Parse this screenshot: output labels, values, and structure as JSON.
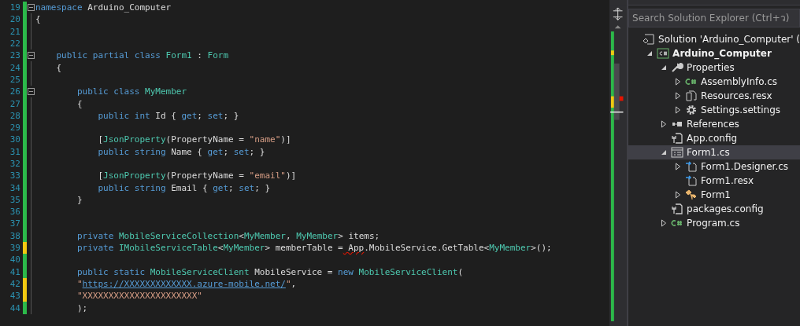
{
  "editor": {
    "lines": [
      {
        "number": "19",
        "color": "#2cb94a",
        "fold": true,
        "tokens": [
          {
            "kind": "kw",
            "text": "namespace"
          },
          {
            "kind": "plain",
            "text": " Arduino_Computer"
          }
        ]
      },
      {
        "number": "20",
        "color": "#2cb94a",
        "fold": false,
        "tokens": [
          {
            "kind": "plain",
            "text": "{"
          }
        ]
      },
      {
        "number": "21",
        "color": "#2cb94a",
        "fold": false
      },
      {
        "number": "22",
        "color": "#2cb94a",
        "fold": false
      },
      {
        "number": "23",
        "color": "#2cb94a",
        "fold": true,
        "tokens": [
          {
            "kind": "kw",
            "text": "    public partial class"
          },
          {
            "kind": "type",
            "text": " Form1"
          },
          {
            "kind": "plain",
            "text": " :"
          },
          {
            "kind": "type",
            "text": " Form"
          }
        ]
      },
      {
        "number": "24",
        "color": "#2cb94a",
        "fold": false,
        "tokens": [
          {
            "kind": "plain",
            "text": "    {"
          }
        ]
      },
      {
        "number": "25",
        "color": "#2cb94a",
        "fold": false
      },
      {
        "number": "26",
        "color": "#2cb94a",
        "fold": true,
        "tokens": [
          {
            "kind": "kw",
            "text": "        public class"
          },
          {
            "kind": "type",
            "text": " MyMember"
          }
        ]
      },
      {
        "number": "27",
        "color": "#2cb94a",
        "fold": false,
        "tokens": [
          {
            "kind": "plain",
            "text": "        {"
          }
        ]
      },
      {
        "number": "28",
        "color": "#2cb94a",
        "fold": false,
        "tokens": [
          {
            "kind": "kw",
            "text": "            public int"
          },
          {
            "kind": "plain",
            "text": " Id {"
          },
          {
            "kind": "kw",
            "text": " get"
          },
          {
            "kind": "plain",
            "text": ";"
          },
          {
            "kind": "kw",
            "text": " set"
          },
          {
            "kind": "plain",
            "text": "; }"
          }
        ]
      },
      {
        "number": "29",
        "color": "#2cb94a",
        "fold": false
      },
      {
        "number": "30",
        "color": "#2cb94a",
        "fold": false,
        "tokens": [
          {
            "kind": "plain",
            "text": "            ["
          },
          {
            "kind": "type",
            "text": "JsonProperty"
          },
          {
            "kind": "plain",
            "text": "(PropertyName ="
          },
          {
            "kind": "str",
            "text": " \"name\""
          },
          {
            "kind": "plain",
            "text": ")]"
          }
        ]
      },
      {
        "number": "31",
        "color": "#2cb94a",
        "fold": false,
        "tokens": [
          {
            "kind": "kw",
            "text": "            public string"
          },
          {
            "kind": "plain",
            "text": " Name {"
          },
          {
            "kind": "kw",
            "text": " get"
          },
          {
            "kind": "plain",
            "text": ";"
          },
          {
            "kind": "kw",
            "text": " set"
          },
          {
            "kind": "plain",
            "text": "; }"
          }
        ]
      },
      {
        "number": "32",
        "color": "#2cb94a",
        "fold": false
      },
      {
        "number": "33",
        "color": "#2cb94a",
        "fold": false,
        "tokens": [
          {
            "kind": "plain",
            "text": "            ["
          },
          {
            "kind": "type",
            "text": "JsonProperty"
          },
          {
            "kind": "plain",
            "text": "(PropertyName ="
          },
          {
            "kind": "str",
            "text": " \"email\""
          },
          {
            "kind": "plain",
            "text": ")]"
          }
        ]
      },
      {
        "number": "34",
        "color": "#2cb94a",
        "fold": false,
        "tokens": [
          {
            "kind": "kw",
            "text": "            public string"
          },
          {
            "kind": "plain",
            "text": " Email {"
          },
          {
            "kind": "kw",
            "text": " get"
          },
          {
            "kind": "plain",
            "text": ";"
          },
          {
            "kind": "kw",
            "text": " set"
          },
          {
            "kind": "plain",
            "text": "; }"
          }
        ]
      },
      {
        "number": "35",
        "color": "#2cb94a",
        "fold": false,
        "tokens": [
          {
            "kind": "plain",
            "text": "        }"
          }
        ]
      },
      {
        "number": "36",
        "color": "#2cb94a",
        "fold": false
      },
      {
        "number": "37",
        "color": "#2cb94a",
        "fold": false
      },
      {
        "number": "38",
        "color": "#2cb94a",
        "fold": false,
        "tokens": [
          {
            "kind": "kw",
            "text": "        private"
          },
          {
            "kind": "type",
            "text": " MobileServiceCollection"
          },
          {
            "kind": "plain",
            "text": "<"
          },
          {
            "kind": "type",
            "text": "MyMember"
          },
          {
            "kind": "plain",
            "text": ","
          },
          {
            "kind": "type",
            "text": " MyMember"
          },
          {
            "kind": "plain",
            "text": "> items;"
          }
        ]
      },
      {
        "number": "39",
        "color": "#f2c811",
        "fold": false,
        "tokens": [
          {
            "kind": "kw",
            "text": "        private"
          },
          {
            "kind": "type",
            "text": " IMobileServiceTable"
          },
          {
            "kind": "plain",
            "text": "<"
          },
          {
            "kind": "type",
            "text": "MyMember"
          },
          {
            "kind": "plain",
            "text": "> memberTable ="
          },
          {
            "kind": "error",
            "text": " App"
          },
          {
            "kind": "plain",
            "text": ".MobileService.GetTable<"
          },
          {
            "kind": "type",
            "text": "MyMember"
          },
          {
            "kind": "plain",
            "text": ">();"
          }
        ]
      },
      {
        "number": "40",
        "color": "#2cb94a",
        "fold": false
      },
      {
        "number": "41",
        "color": "#2cb94a",
        "fold": false,
        "tokens": [
          {
            "kind": "kw",
            "text": "        public static"
          },
          {
            "kind": "type",
            "text": " MobileServiceClient"
          },
          {
            "kind": "plain",
            "text": " MobileService ="
          },
          {
            "kind": "kw",
            "text": " new"
          },
          {
            "kind": "type",
            "text": " MobileServiceClient"
          },
          {
            "kind": "plain",
            "text": "("
          }
        ]
      },
      {
        "number": "42",
        "color": "#f2c811",
        "fold": false,
        "tokens": [
          {
            "kind": "str",
            "text": "        \""
          },
          {
            "kind": "link",
            "text": "https://XXXXXXXXXXXXX.azure-mobile.net/"
          },
          {
            "kind": "str",
            "text": "\""
          },
          {
            "kind": "plain",
            "text": ","
          }
        ]
      },
      {
        "number": "43",
        "color": "#f2c811",
        "fold": false,
        "tokens": [
          {
            "kind": "str",
            "text": "        \"XXXXXXXXXXXXXXXXXXXXXX\""
          }
        ]
      },
      {
        "number": "44",
        "color": "#2cb94a",
        "fold": false,
        "tokens": [
          {
            "kind": "plain",
            "text": "        );"
          }
        ]
      }
    ]
  },
  "solution_explorer": {
    "search": {
      "placeholder": "Search Solution Explorer (Ctrl+ว)"
    },
    "tree": [
      {
        "label": "Solution 'Arduino_Computer' (",
        "kind": "solution",
        "selected": false,
        "children": [
          {
            "label": "Arduino_Computer",
            "kind": "project",
            "expanded": true,
            "selected": false,
            "children": [
              {
                "label": "Properties",
                "kind": "wrench",
                "expanded": true,
                "selected": false,
                "children": [
                  {
                    "label": "AssemblyInfo.cs",
                    "kind": "cs",
                    "expanded": false,
                    "selected": false
                  },
                  {
                    "label": "Resources.resx",
                    "kind": "resx",
                    "expanded": false,
                    "selected": false
                  },
                  {
                    "label": "Settings.settings",
                    "kind": "gear",
                    "expanded": false,
                    "selected": false
                  }
                ]
              },
              {
                "label": "References",
                "kind": "references",
                "expanded": false,
                "selected": false
              },
              {
                "label": "App.config",
                "kind": "config",
                "selected": false
              },
              {
                "label": "Form1.cs",
                "kind": "form",
                "expanded": true,
                "selected": true,
                "children": [
                  {
                    "label": "Form1.Designer.cs",
                    "kind": "designer",
                    "expanded": false,
                    "selected": false
                  },
                  {
                    "label": "Form1.resx",
                    "kind": "designer",
                    "selected": false
                  },
                  {
                    "label": "Form1",
                    "kind": "class",
                    "expanded": false,
                    "selected": false
                  }
                ]
              },
              {
                "label": "packages.config",
                "kind": "config",
                "selected": false
              },
              {
                "label": "Program.cs",
                "kind": "cs",
                "expanded": false,
                "selected": false
              }
            ]
          }
        ]
      }
    ]
  }
}
